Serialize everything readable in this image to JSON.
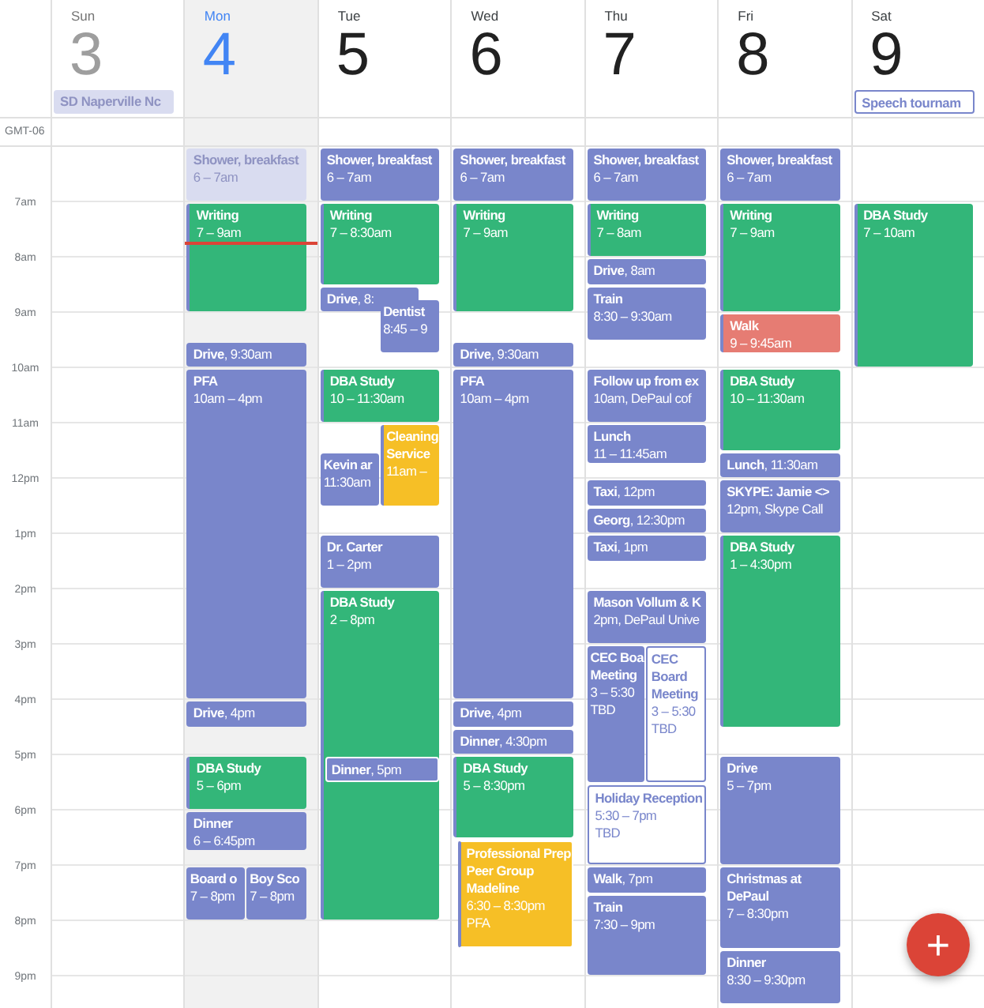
{
  "timezone": "GMT-06",
  "hours": [
    "7am",
    "8am",
    "9am",
    "10am",
    "11am",
    "12pm",
    "1pm",
    "2pm",
    "3pm",
    "4pm",
    "5pm",
    "6pm",
    "7pm",
    "8pm",
    "9pm"
  ],
  "days": [
    {
      "name": "Sun",
      "number": "3",
      "past": true,
      "today": false,
      "all_day": [
        {
          "title": "SD Naperville Nc",
          "kind": "event",
          "color": "#d9dcf0",
          "past": true
        }
      ]
    },
    {
      "name": "Mon",
      "number": "4",
      "past": false,
      "today": true,
      "events": [
        {
          "title": "Shower, breakfast",
          "details": [
            "6 – 7am"
          ],
          "color": "#d9dcf0",
          "kind": "event",
          "past": true
        },
        {
          "title": "Writing",
          "details": [
            "7 – 9am"
          ],
          "color": "#33b679",
          "kind": "event",
          "past": false
        },
        {
          "title": "**Drive**, 9:30am",
          "color": "#7986cb",
          "kind": "event",
          "past": false
        },
        {
          "title": "PFA",
          "details": [
            "10am – 4pm"
          ],
          "color": "#7986cb",
          "kind": "event",
          "past": false
        },
        {
          "title": "**Drive**, 4pm",
          "color": "#7986cb",
          "kind": "event",
          "past": false
        },
        {
          "title": "DBA Study",
          "details": [
            "5 – 6pm"
          ],
          "color": "#33b679",
          "kind": "event",
          "past": false
        },
        {
          "title": "Dinner",
          "details": [
            "6 – 6:45pm"
          ],
          "color": "#7986cb",
          "kind": "event",
          "past": false
        },
        {
          "title": "Board o",
          "details": [
            "7 – 8pm"
          ],
          "color": "#7986cb",
          "kind": "event",
          "past": false
        },
        {
          "title": "Boy Sco",
          "details": [
            "7 – 8pm"
          ],
          "color": "#7986cb",
          "kind": "event",
          "past": false
        }
      ]
    },
    {
      "name": "Tue",
      "number": "5",
      "past": false,
      "today": false,
      "events": [
        {
          "title": "Shower, breakfast",
          "details": [
            "6 – 7am"
          ],
          "color": "#7986cb",
          "kind": "event",
          "past": false
        },
        {
          "title": "Writing",
          "details": [
            "7 – 8:30am"
          ],
          "color": "#33b679",
          "kind": "event",
          "past": false
        },
        {
          "title": "**Drive**, 8:",
          "color": "#7986cb",
          "kind": "event",
          "past": false
        },
        {
          "title": "Dentist",
          "details": [
            "8:45 – 9"
          ],
          "color": "#7986cb",
          "kind": "event",
          "past": false
        },
        {
          "title": "DBA Study",
          "details": [
            "10 – 11:30am"
          ],
          "color": "#33b679",
          "kind": "event",
          "past": false
        },
        {
          "title": "Kevin ar",
          "details": [
            "11:30am"
          ],
          "color": "#7986cb",
          "kind": "event",
          "past": false
        },
        {
          "title": "Cleaning Service",
          "details": [
            "11am –"
          ],
          "color": "#f6bf26",
          "kind": "event",
          "past": false
        },
        {
          "title": "Dr. Carter",
          "details": [
            "1 – 2pm"
          ],
          "color": "#7986cb",
          "kind": "event",
          "past": false
        },
        {
          "title": "DBA Study",
          "details": [
            "2 – 8pm"
          ],
          "color": "#33b679",
          "kind": "event",
          "past": false
        },
        {
          "title": "**Dinner**, 5pm",
          "color": "#7986cb",
          "kind": "event",
          "past": false
        }
      ]
    },
    {
      "name": "Wed",
      "number": "6",
      "past": false,
      "today": false,
      "events": [
        {
          "title": "Shower, breakfast",
          "details": [
            "6 – 7am"
          ],
          "color": "#7986cb",
          "kind": "event",
          "past": false
        },
        {
          "title": "Writing",
          "details": [
            "7 – 9am"
          ],
          "color": "#33b679",
          "kind": "event",
          "past": false
        },
        {
          "title": "**Drive**, 9:30am",
          "color": "#7986cb",
          "kind": "event",
          "past": false
        },
        {
          "title": "PFA",
          "details": [
            "10am – 4pm"
          ],
          "color": "#7986cb",
          "kind": "event",
          "past": false
        },
        {
          "title": "**Drive**, 4pm",
          "color": "#7986cb",
          "kind": "event",
          "past": false
        },
        {
          "title": "**Dinner**, 4:30pm",
          "color": "#7986cb",
          "kind": "event",
          "past": false
        },
        {
          "title": "DBA Study",
          "details": [
            "5 – 8:30pm"
          ],
          "color": "#33b679",
          "kind": "event",
          "past": false
        },
        {
          "title": "Professional Prep Peer Group Madeline",
          "details": [
            "6:30 – 8:30pm",
            "PFA"
          ],
          "color": "#f6bf26",
          "kind": "event",
          "past": false
        }
      ]
    },
    {
      "name": "Thu",
      "number": "7",
      "past": false,
      "today": false,
      "events": [
        {
          "title": "Shower, breakfast",
          "details": [
            "6 – 7am"
          ],
          "color": "#7986cb",
          "kind": "event",
          "past": false
        },
        {
          "title": "Writing",
          "details": [
            "7 – 8am"
          ],
          "color": "#33b679",
          "kind": "event",
          "past": false
        },
        {
          "title": "**Drive**, 8am",
          "color": "#7986cb",
          "kind": "event",
          "past": false
        },
        {
          "title": "Train",
          "details": [
            "8:30 – 9:30am"
          ],
          "color": "#7986cb",
          "kind": "event",
          "past": false
        },
        {
          "title": "Follow up from ex",
          "details": [
            "10am, DePaul cof"
          ],
          "color": "#7986cb",
          "kind": "event",
          "past": false
        },
        {
          "title": "Lunch",
          "details": [
            "11 – 11:45am"
          ],
          "color": "#7986cb",
          "kind": "event",
          "past": false
        },
        {
          "title": "**Taxi**, 12pm",
          "color": "#7986cb",
          "kind": "event",
          "past": false
        },
        {
          "title": "**Georg**, 12:30pm",
          "color": "#7986cb",
          "kind": "event",
          "past": false
        },
        {
          "title": "**Taxi**, 1pm",
          "color": "#7986cb",
          "kind": "event",
          "past": false
        },
        {
          "title": "Mason Vollum & K",
          "details": [
            "2pm, DePaul Unive"
          ],
          "color": "#7986cb",
          "kind": "event",
          "past": false
        },
        {
          "title": "CEC Boa\nMeeting",
          "details": [
            "3 – 5:30",
            "TBD"
          ],
          "color": "#7986cb",
          "kind": "event",
          "past": false
        },
        {
          "title": "CEC Board Meeting",
          "details": [
            "3 – 5:30",
            "TBD"
          ],
          "color": "#7986cb",
          "kind": "invitation",
          "past": false
        },
        {
          "title": "Holiday Reception",
          "details": [
            "5:30 – 7pm",
            "TBD"
          ],
          "color": "#7986cb",
          "kind": "invitation",
          "past": false
        },
        {
          "title": "**Walk**, 7pm",
          "color": "#7986cb",
          "kind": "event",
          "past": false
        },
        {
          "title": "Train",
          "details": [
            "7:30 – 9pm"
          ],
          "color": "#7986cb",
          "kind": "event",
          "past": false
        }
      ]
    },
    {
      "name": "Fri",
      "number": "8",
      "past": false,
      "today": false,
      "events": [
        {
          "title": "Shower, breakfast",
          "details": [
            "6 – 7am"
          ],
          "color": "#7986cb",
          "kind": "event",
          "past": false
        },
        {
          "title": "Writing",
          "details": [
            "7 – 9am"
          ],
          "color": "#33b679",
          "kind": "event",
          "past": false
        },
        {
          "title": "Walk",
          "details": [
            "9 – 9:45am"
          ],
          "color": "#e67c73",
          "kind": "event",
          "past": false
        },
        {
          "title": "DBA Study",
          "details": [
            "10 – 11:30am"
          ],
          "color": "#33b679",
          "kind": "event",
          "past": false
        },
        {
          "title": "**Lunch**, 11:30am",
          "color": "#7986cb",
          "kind": "event",
          "past": false
        },
        {
          "title": "SKYPE: Jamie <>",
          "details": [
            "12pm, Skype Call"
          ],
          "color": "#7986cb",
          "kind": "event",
          "past": false
        },
        {
          "title": "DBA Study",
          "details": [
            "1 – 4:30pm"
          ],
          "color": "#33b679",
          "kind": "event",
          "past": false
        },
        {
          "title": "Drive",
          "details": [
            "5 – 7pm"
          ],
          "color": "#7986cb",
          "kind": "event",
          "past": false
        },
        {
          "title": "Christmas at DePaul",
          "details": [
            "7 – 8:30pm"
          ],
          "color": "#7986cb",
          "kind": "event",
          "past": false
        },
        {
          "title": "Dinner",
          "details": [
            "8:30 – 9:30pm"
          ],
          "color": "#7986cb",
          "kind": "event",
          "past": false
        }
      ]
    },
    {
      "name": "Sat",
      "number": "9",
      "past": false,
      "today": false,
      "all_day": [
        {
          "title": "Speech tournam",
          "kind": "invitation",
          "color": "#7986cb",
          "past": false
        }
      ],
      "events": [
        {
          "title": "DBA Study",
          "details": [
            "7 – 10am"
          ],
          "color": "#33b679",
          "kind": "event",
          "past": false
        }
      ]
    }
  ],
  "fab": {
    "label": "+"
  }
}
